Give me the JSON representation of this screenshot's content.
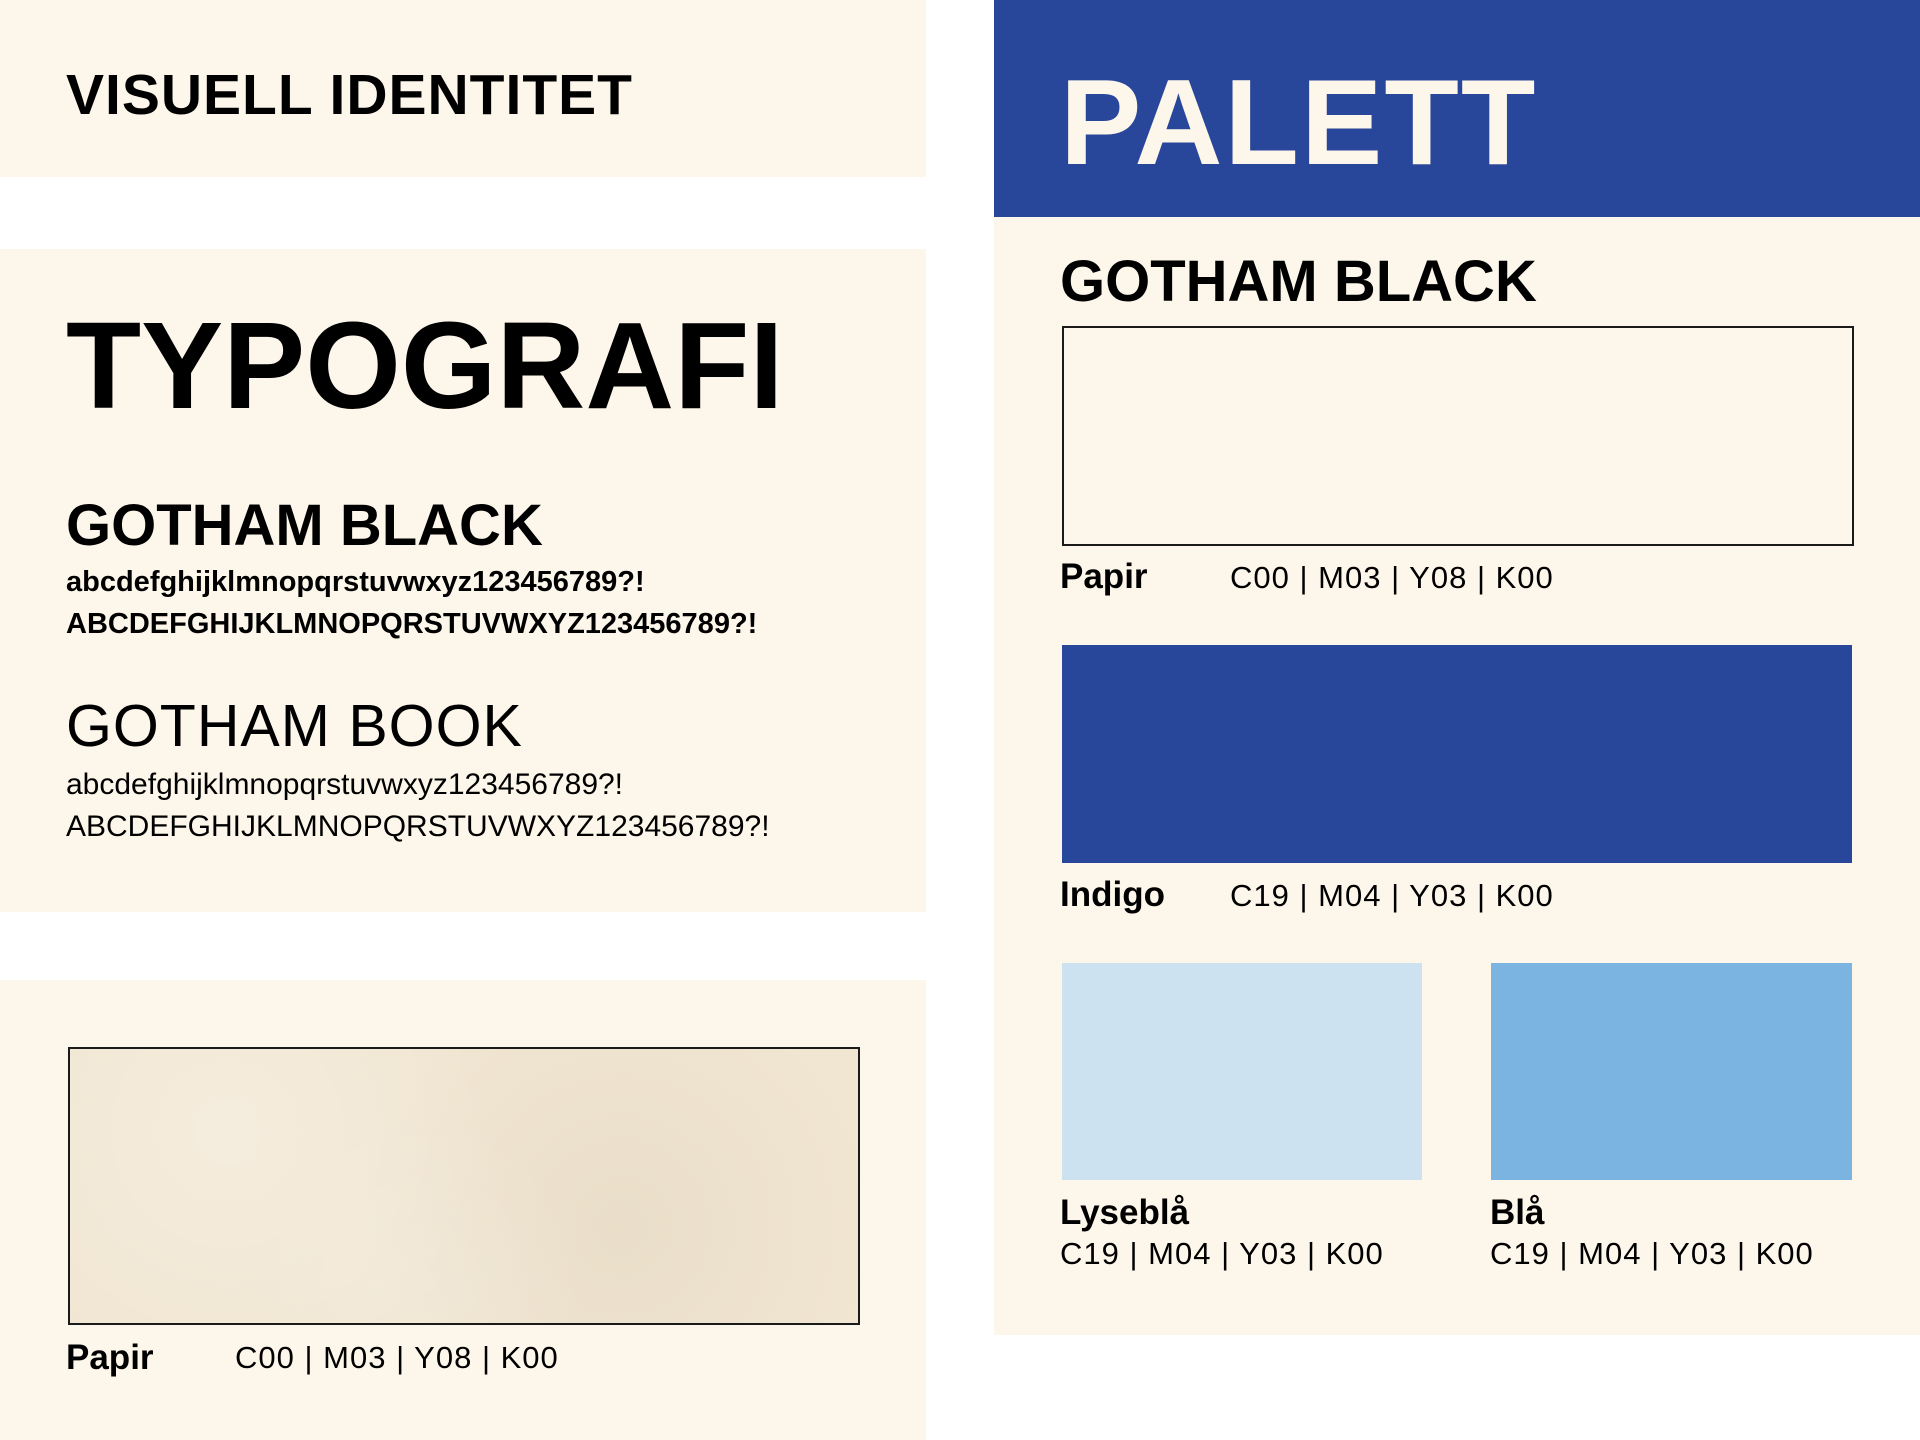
{
  "left": {
    "visuell_title": "VISUELL IDENTITET",
    "typografi_title": "TYPOGRAFI",
    "gotham_black": {
      "name": "GOTHAM BLACK",
      "lower": "abcdefghijklmnopqrstuvwxyz123456789?!",
      "upper": "ABCDEFGHIJKLMNOPQRSTUVWXYZ123456789?!"
    },
    "gotham_book": {
      "name": "GOTHAM BOOK",
      "lower": "abcdefghijklmnopqrstuvwxyz123456789?!",
      "upper": "ABCDEFGHIJKLMNOPQRSTUVWXYZ123456789?!"
    },
    "paper": {
      "label": "Papir",
      "code": "C00 | M03 | Y08 | K00",
      "color": "#f1e6d2"
    }
  },
  "right": {
    "palett_title": "PALETT",
    "font_name": "GOTHAM BLACK",
    "header_color": "#29479a",
    "panel_color": "#fdf6ea",
    "swatches": [
      {
        "label": "Papir",
        "code": "C00 | M03 | Y08 | K00",
        "color": "#fdf6ea"
      },
      {
        "label": "Indigo",
        "code": "C19 | M04 | Y03 | K00",
        "color": "#29479a"
      },
      {
        "label": "Lyseblå",
        "code": "C19 | M04 | Y03 | K00",
        "color": "#cce2f1"
      },
      {
        "label": "Blå",
        "code": "C19 | M04 | Y03 | K00",
        "color": "#7bb4e1"
      }
    ]
  }
}
